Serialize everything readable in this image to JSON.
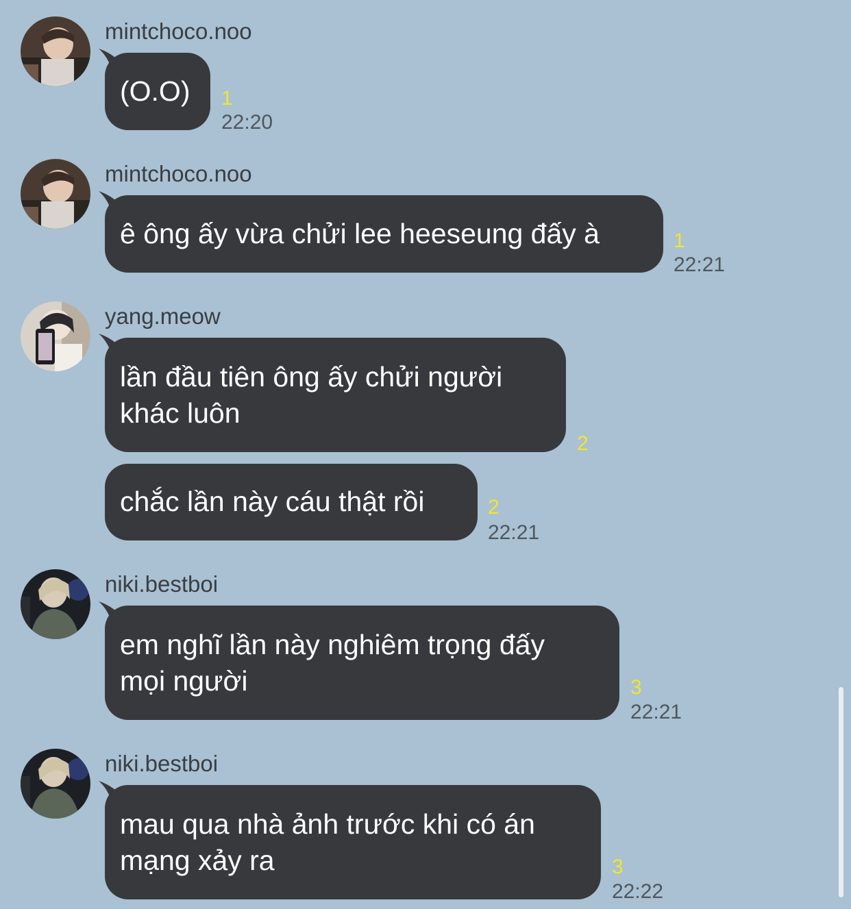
{
  "messages": [
    {
      "sender": "mintchoco.noo",
      "avatar": "user-avatar",
      "lines": [
        "(O.O)"
      ],
      "unread": "1",
      "time": "22:20"
    },
    {
      "sender": "mintchoco.noo",
      "avatar": "user-avatar",
      "lines": [
        "ê ông ấy vừa chửi lee heeseung đấy à"
      ],
      "unread": "1",
      "time": "22:21"
    },
    {
      "sender": "yang.meow",
      "avatar": "user-avatar",
      "lines": [
        "lần đầu tiên ông ấy chửi người",
        "khác luôn"
      ],
      "unread": "2",
      "time": ""
    },
    {
      "sender": "",
      "avatar": "",
      "lines": [
        "chắc lần này cáu thật rồi"
      ],
      "unread": "2",
      "time": "22:21"
    },
    {
      "sender": "niki.bestboi",
      "avatar": "user-avatar",
      "lines": [
        "em nghĩ lần này nghiêm trọng đấy",
        "mọi người"
      ],
      "unread": "3",
      "time": "22:21"
    },
    {
      "sender": "niki.bestboi",
      "avatar": "user-avatar",
      "lines": [
        "mau qua nhà ảnh trước khi có án",
        "mạng xảy ra"
      ],
      "unread": "3",
      "time": "22:22"
    }
  ],
  "colors": {
    "background": "#a9c1d2",
    "bubble": "#38393d",
    "bubble_text": "#ffffff",
    "unread_count": "#f3e52f",
    "timestamp": "#4f565d",
    "sender_name": "#3a3e44"
  }
}
